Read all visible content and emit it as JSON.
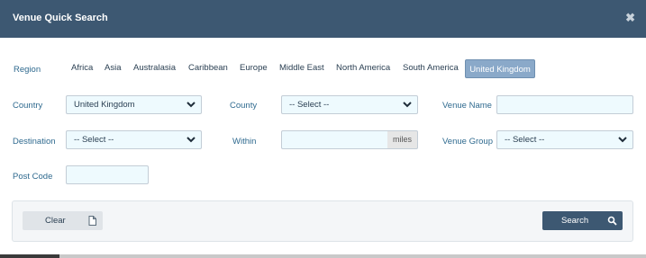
{
  "header": {
    "title": "Venue Quick Search",
    "close_icon": "close-icon"
  },
  "region": {
    "label": "Region",
    "items": [
      "Africa",
      "Asia",
      "Australasia",
      "Caribbean",
      "Europe",
      "Middle East",
      "North America",
      "South America",
      "United Kingdom"
    ],
    "selected": "United Kingdom"
  },
  "fields": {
    "country": {
      "label": "Country",
      "value": "United Kingdom"
    },
    "county": {
      "label": "County",
      "value": "-- Select --"
    },
    "venue_name": {
      "label": "Venue Name",
      "value": ""
    },
    "destination": {
      "label": "Destination",
      "value": "-- Select --"
    },
    "within": {
      "label": "Within",
      "value": "",
      "unit": "miles"
    },
    "venue_group": {
      "label": "Venue Group",
      "value": "-- Select --"
    },
    "post_code": {
      "label": "Post Code",
      "value": ""
    }
  },
  "buttons": {
    "clear": {
      "label": "Clear",
      "icon": "file-icon"
    },
    "search": {
      "label": "Search",
      "icon": "search-icon"
    }
  },
  "colors": {
    "header": "#3d5872",
    "active_region": "#8aa9c9",
    "field_bg": "#eefafe",
    "label": "#2f6a8f"
  }
}
